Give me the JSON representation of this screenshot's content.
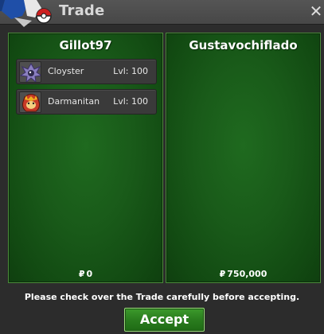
{
  "window": {
    "title": "Trade",
    "close_glyph": "✕"
  },
  "icons": {
    "emblem": "pokeball-emblem-icon",
    "close": "close-icon"
  },
  "left_trader": {
    "name": "Gillot97",
    "offer": [
      {
        "pokemon": "Cloyster",
        "level": "Lvl: 100",
        "icon": "cloyster-sprite-icon"
      },
      {
        "pokemon": "Darmanitan",
        "level": "Lvl: 100",
        "icon": "darmanitan-sprite-icon"
      }
    ],
    "currency_symbol": "₽",
    "money": "0"
  },
  "right_trader": {
    "name": "Gustavochiflado",
    "offer": [],
    "currency_symbol": "₽",
    "money": "750,000"
  },
  "footer": {
    "notice": "Please check over the Trade carefully before accepting.",
    "accept_label": "Accept"
  },
  "colors": {
    "panel_green": "#195a19",
    "accept_green": "#2a7d1e",
    "titlebar": "#4a4a4a"
  }
}
